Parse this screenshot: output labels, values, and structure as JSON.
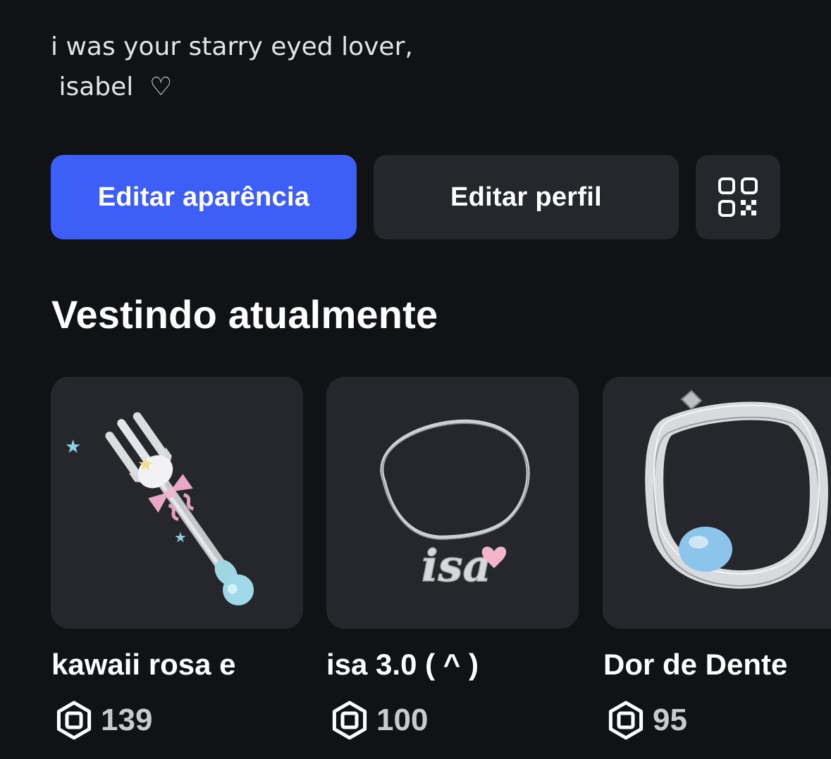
{
  "profile": {
    "bio_lines": [
      "i was your starry eyed lover,",
      " isabel  ♡"
    ]
  },
  "actions": {
    "edit_appearance_label": "Editar aparência",
    "edit_profile_label": "Editar perfil",
    "qr_icon": "qr-code-icon"
  },
  "wearing": {
    "title": "Vestindo atualmente",
    "items": [
      {
        "name": "kawaii rosa e",
        "price": "139",
        "icon": "fork-wand-icon"
      },
      {
        "name": "isa 3.0 ( ^ )",
        "price": "100",
        "icon": "isa-necklace-icon"
      },
      {
        "name": "Dor de Dente",
        "price": "95",
        "icon": "silver-choker-icon"
      }
    ]
  },
  "colors": {
    "background": "#111216",
    "primary_button": "#3d5ef7",
    "secondary_button": "#26272c",
    "card": "#26272c"
  },
  "currency_icon": "robux-icon"
}
